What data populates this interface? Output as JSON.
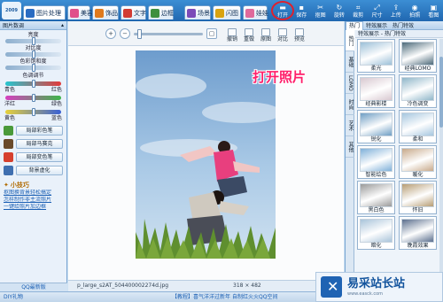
{
  "app": {
    "logo": "2009"
  },
  "tabs": [
    {
      "label": "图片处理",
      "color": "#2a6cc2"
    },
    {
      "label": "美容",
      "color": "#e0508a"
    },
    {
      "label": "饰品",
      "color": "#e07a1c"
    },
    {
      "label": "文字",
      "color": "#d23b32"
    },
    {
      "label": "边框",
      "color": "#3e8f3e"
    },
    {
      "label": "场景",
      "color": "#7b4ab8"
    },
    {
      "label": "闪图",
      "color": "#d9a310"
    },
    {
      "label": "娃娃",
      "color": "#e06a9c"
    }
  ],
  "toolbar": [
    {
      "label": "打开",
      "icon": "open-folder-icon",
      "glyph": "▬"
    },
    {
      "label": "保存",
      "icon": "save-icon",
      "glyph": "▪"
    },
    {
      "label": "抠图",
      "icon": "cutout-icon",
      "glyph": "✂"
    },
    {
      "label": "旋转",
      "icon": "rotate-icon",
      "glyph": "↻"
    },
    {
      "label": "裁剪",
      "icon": "crop-icon",
      "glyph": "⌗"
    },
    {
      "label": "尺寸",
      "icon": "resize-icon",
      "glyph": "⤢"
    },
    {
      "label": "上传",
      "icon": "upload-icon",
      "glyph": "⇪"
    },
    {
      "label": "拍照",
      "icon": "camera-icon",
      "glyph": "◉"
    },
    {
      "label": "看图",
      "icon": "view-icon",
      "glyph": "▣"
    }
  ],
  "left_panel": {
    "header": "图片数调",
    "sliders": [
      {
        "label": "亮度",
        "value": 0.5
      },
      {
        "label": "对比度",
        "value": 0.5
      },
      {
        "label": "色彩饱和度",
        "value": 0.5
      }
    ],
    "color_header": "色调调节",
    "color_sliders": [
      {
        "left": "青色",
        "right": "红色",
        "value": 0.5
      },
      {
        "left": "洋红",
        "right": "绿色",
        "value": 0.5
      },
      {
        "left": "黄色",
        "right": "蓝色",
        "value": 0.5
      }
    ],
    "buttons": [
      {
        "label": "局部彩色笔",
        "icon": "color-pen-icon",
        "color": "#4a9a3a"
      },
      {
        "label": "局部马赛克",
        "icon": "mosaic-icon",
        "color": "#6a4a2a"
      },
      {
        "label": "局部变色笔",
        "icon": "recolor-pen-icon",
        "color": "#d6402e"
      },
      {
        "label": "背景虚化",
        "icon": "blur-icon",
        "color": "#3f6fb0"
      }
    ],
    "tips_title": "小技巧",
    "tips": [
      "抠图换背景轻松搞定",
      "怎样制作非主流照片",
      "一键给照片加边框"
    ],
    "qq_label": "QQ最新版"
  },
  "center": {
    "tools": [
      "撤销",
      "重做",
      "原图",
      "对比",
      "预览"
    ],
    "overlay_text": "打开照片",
    "file_name": "p_large_s2AT_504400002274d.jpg",
    "dimensions": "318 × 482"
  },
  "right_panel": {
    "top_tabs": [
      "热门",
      "特效展示",
      "热门特效"
    ],
    "vertical_tabs": [
      "热门",
      "基础",
      "LOMO",
      "时尚",
      "艺术",
      "其他"
    ],
    "subheader": "特效展示 - 热门特效",
    "effects": [
      {
        "label": "柔光",
        "tint": "#9cc0d8"
      },
      {
        "label": "经典LOMO",
        "tint": "#4d6a7a"
      },
      {
        "label": "经典影楼",
        "tint": "#d8c8d0"
      },
      {
        "label": "冷色调变",
        "tint": "#8fb6c9"
      },
      {
        "label": "锐化",
        "tint": "#6f9ec4"
      },
      {
        "label": "柔和",
        "tint": "#a6c7df"
      },
      {
        "label": "智能绘色",
        "tint": "#7fb0d9"
      },
      {
        "label": "暖化",
        "tint": "#c8a98a"
      },
      {
        "label": "黑白色",
        "tint": "#9a9a9a"
      },
      {
        "label": "怀旧",
        "tint": "#b79d74"
      },
      {
        "label": "暗化",
        "tint": "#a9c4da"
      },
      {
        "label": "晚霞效果",
        "tint": "#5b6f8e"
      }
    ]
  },
  "status": {
    "left": "DIY礼物",
    "notice": "【教程】喜气洋洋过新年",
    "right": "自制红火火QQ空间"
  },
  "watermark": {
    "title": "易采站长站",
    "sub": "www.easck.com"
  }
}
